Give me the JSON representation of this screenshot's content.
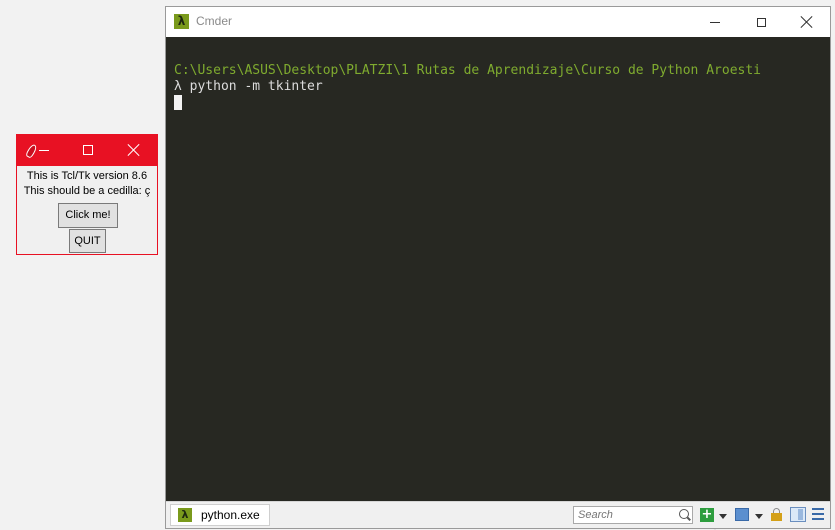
{
  "cmder": {
    "title": "Cmder",
    "terminal": {
      "path_line": "C:\\Users\\ASUS\\Desktop\\PLATZI\\1 Rutas de Aprendizaje\\Curso de Python Aroesti",
      "command_line": "λ python -m tkinter"
    },
    "status": {
      "tab_label": "python.exe",
      "search_placeholder": "Search"
    },
    "colors": {
      "terminal_bg": "#272822",
      "path_text": "#7fab2f",
      "accent": "#7a9a1c"
    },
    "icons": [
      "app-lambda-icon",
      "minimize-icon",
      "maximize-icon",
      "close-icon",
      "search-icon",
      "add-console-icon",
      "console-type-icon",
      "lock-icon",
      "split-icon",
      "menu-icon"
    ]
  },
  "tk": {
    "line1": "This is Tcl/Tk version 8.6",
    "line2": "This should be a cedilla: ç",
    "click_label": "Click me!",
    "quit_label": "QUIT",
    "colors": {
      "titlebar": "#e81123"
    },
    "icons": [
      "feather-icon",
      "minimize-icon",
      "maximize-icon",
      "close-icon"
    ]
  }
}
